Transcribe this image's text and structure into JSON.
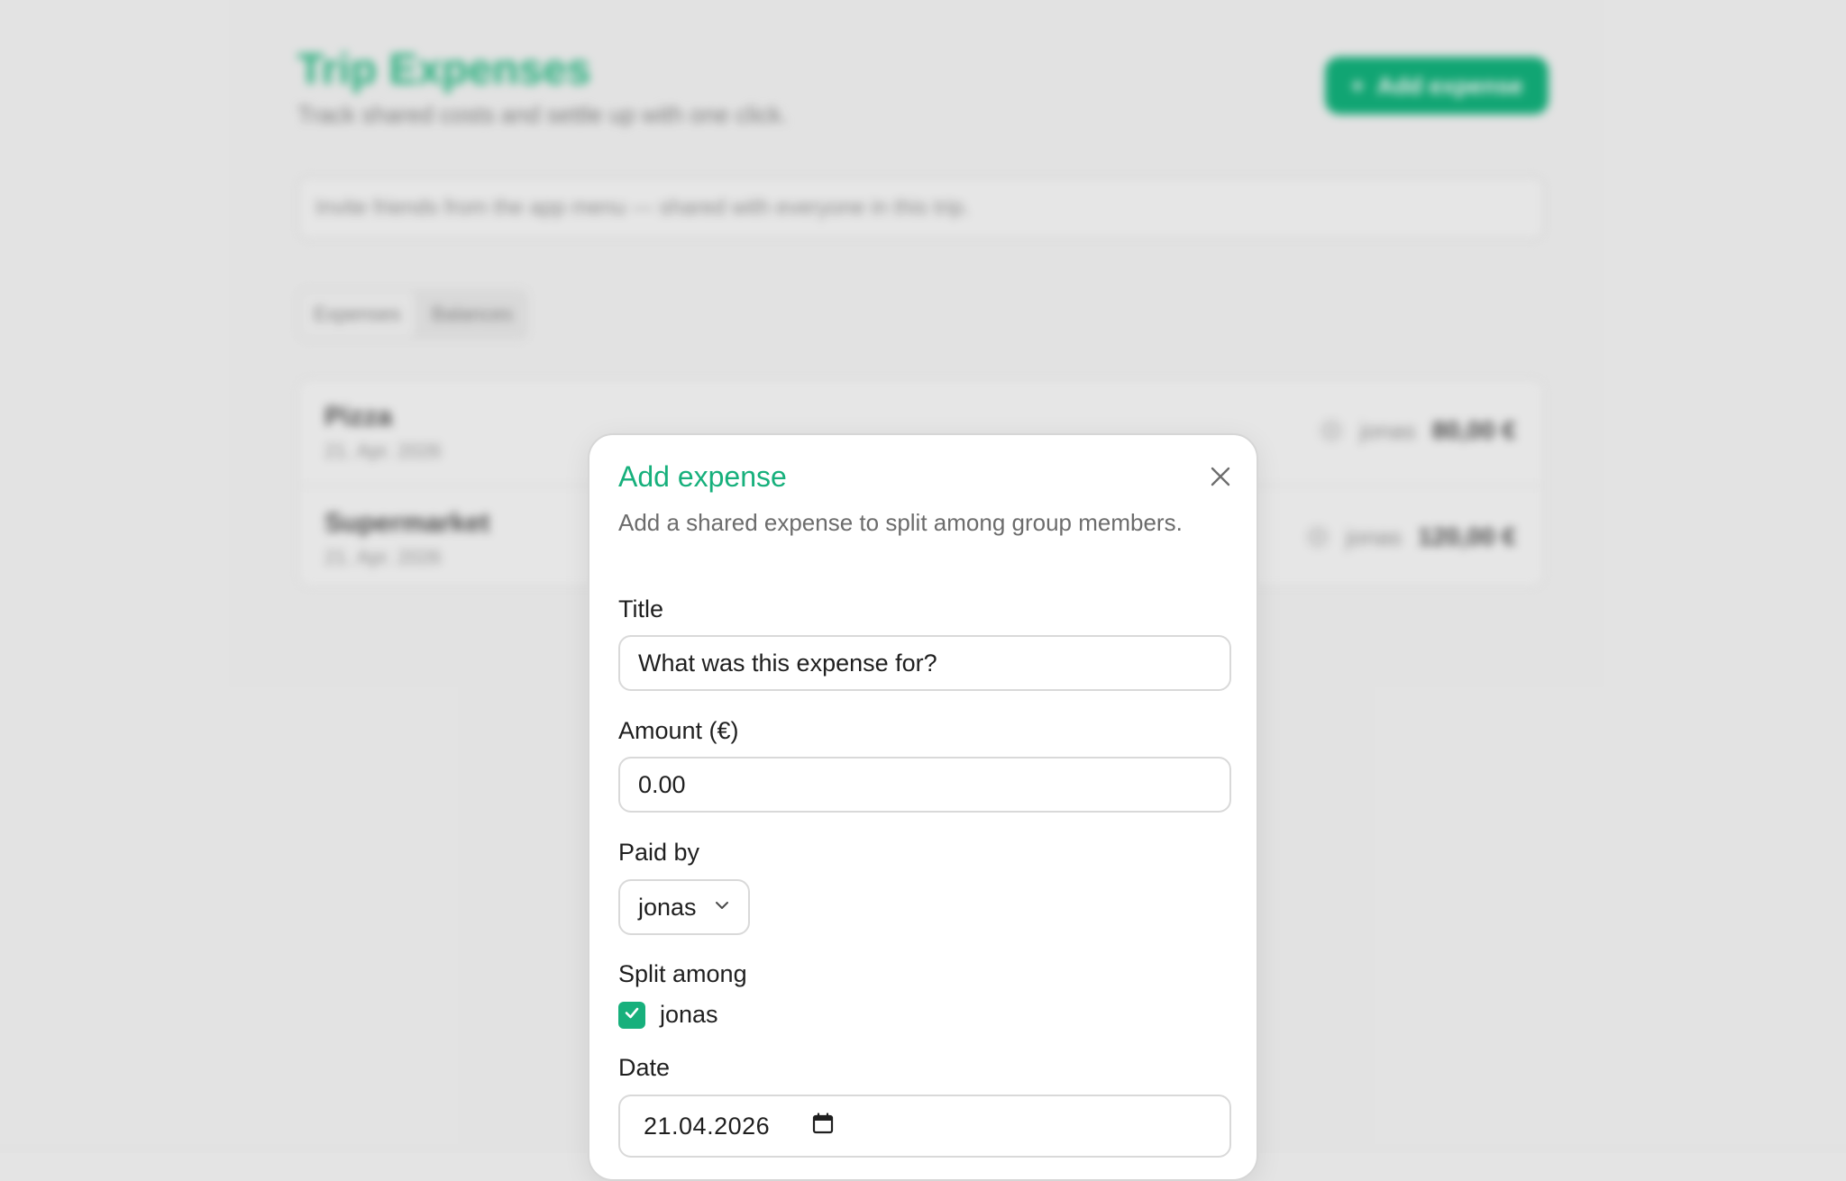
{
  "background": {
    "title": "Trip Expenses",
    "subtitle": "Track shared costs and settle up with one click.",
    "add_button_label": "Add expense",
    "invite_banner": "Invite friends from the app menu — shared with everyone in this trip.",
    "tabs": [
      {
        "label": "Expenses",
        "active": true
      },
      {
        "label": "Balances",
        "active": false
      }
    ],
    "expenses": [
      {
        "title": "Pizza",
        "date": "21. Apr. 2026",
        "payer": "jonas",
        "amount": "80,00 €"
      },
      {
        "title": "Supermarket",
        "date": "21. Apr. 2026",
        "payer": "jonas",
        "amount": "120,00 €"
      }
    ]
  },
  "modal": {
    "title": "Add expense",
    "description": "Add a shared expense to split among group members.",
    "title_label": "Title",
    "title_placeholder": "What was this expense for?",
    "amount_label": "Amount (€)",
    "amount_placeholder": "0.00",
    "paid_by_label": "Paid by",
    "paid_by_value": "jonas",
    "split_label": "Split among",
    "split_members": [
      {
        "name": "jonas",
        "checked": true
      }
    ],
    "date_label": "Date",
    "date_value": "21.04.2026"
  },
  "colors": {
    "accent": "#17b07c",
    "accent_button": "#13b47d",
    "overlay": "#e4e4e4"
  },
  "icons": {
    "close": "close-icon",
    "chevron": "chevron-down-icon",
    "check": "check-icon",
    "calendar": "calendar-icon",
    "plus": "plus-icon"
  }
}
